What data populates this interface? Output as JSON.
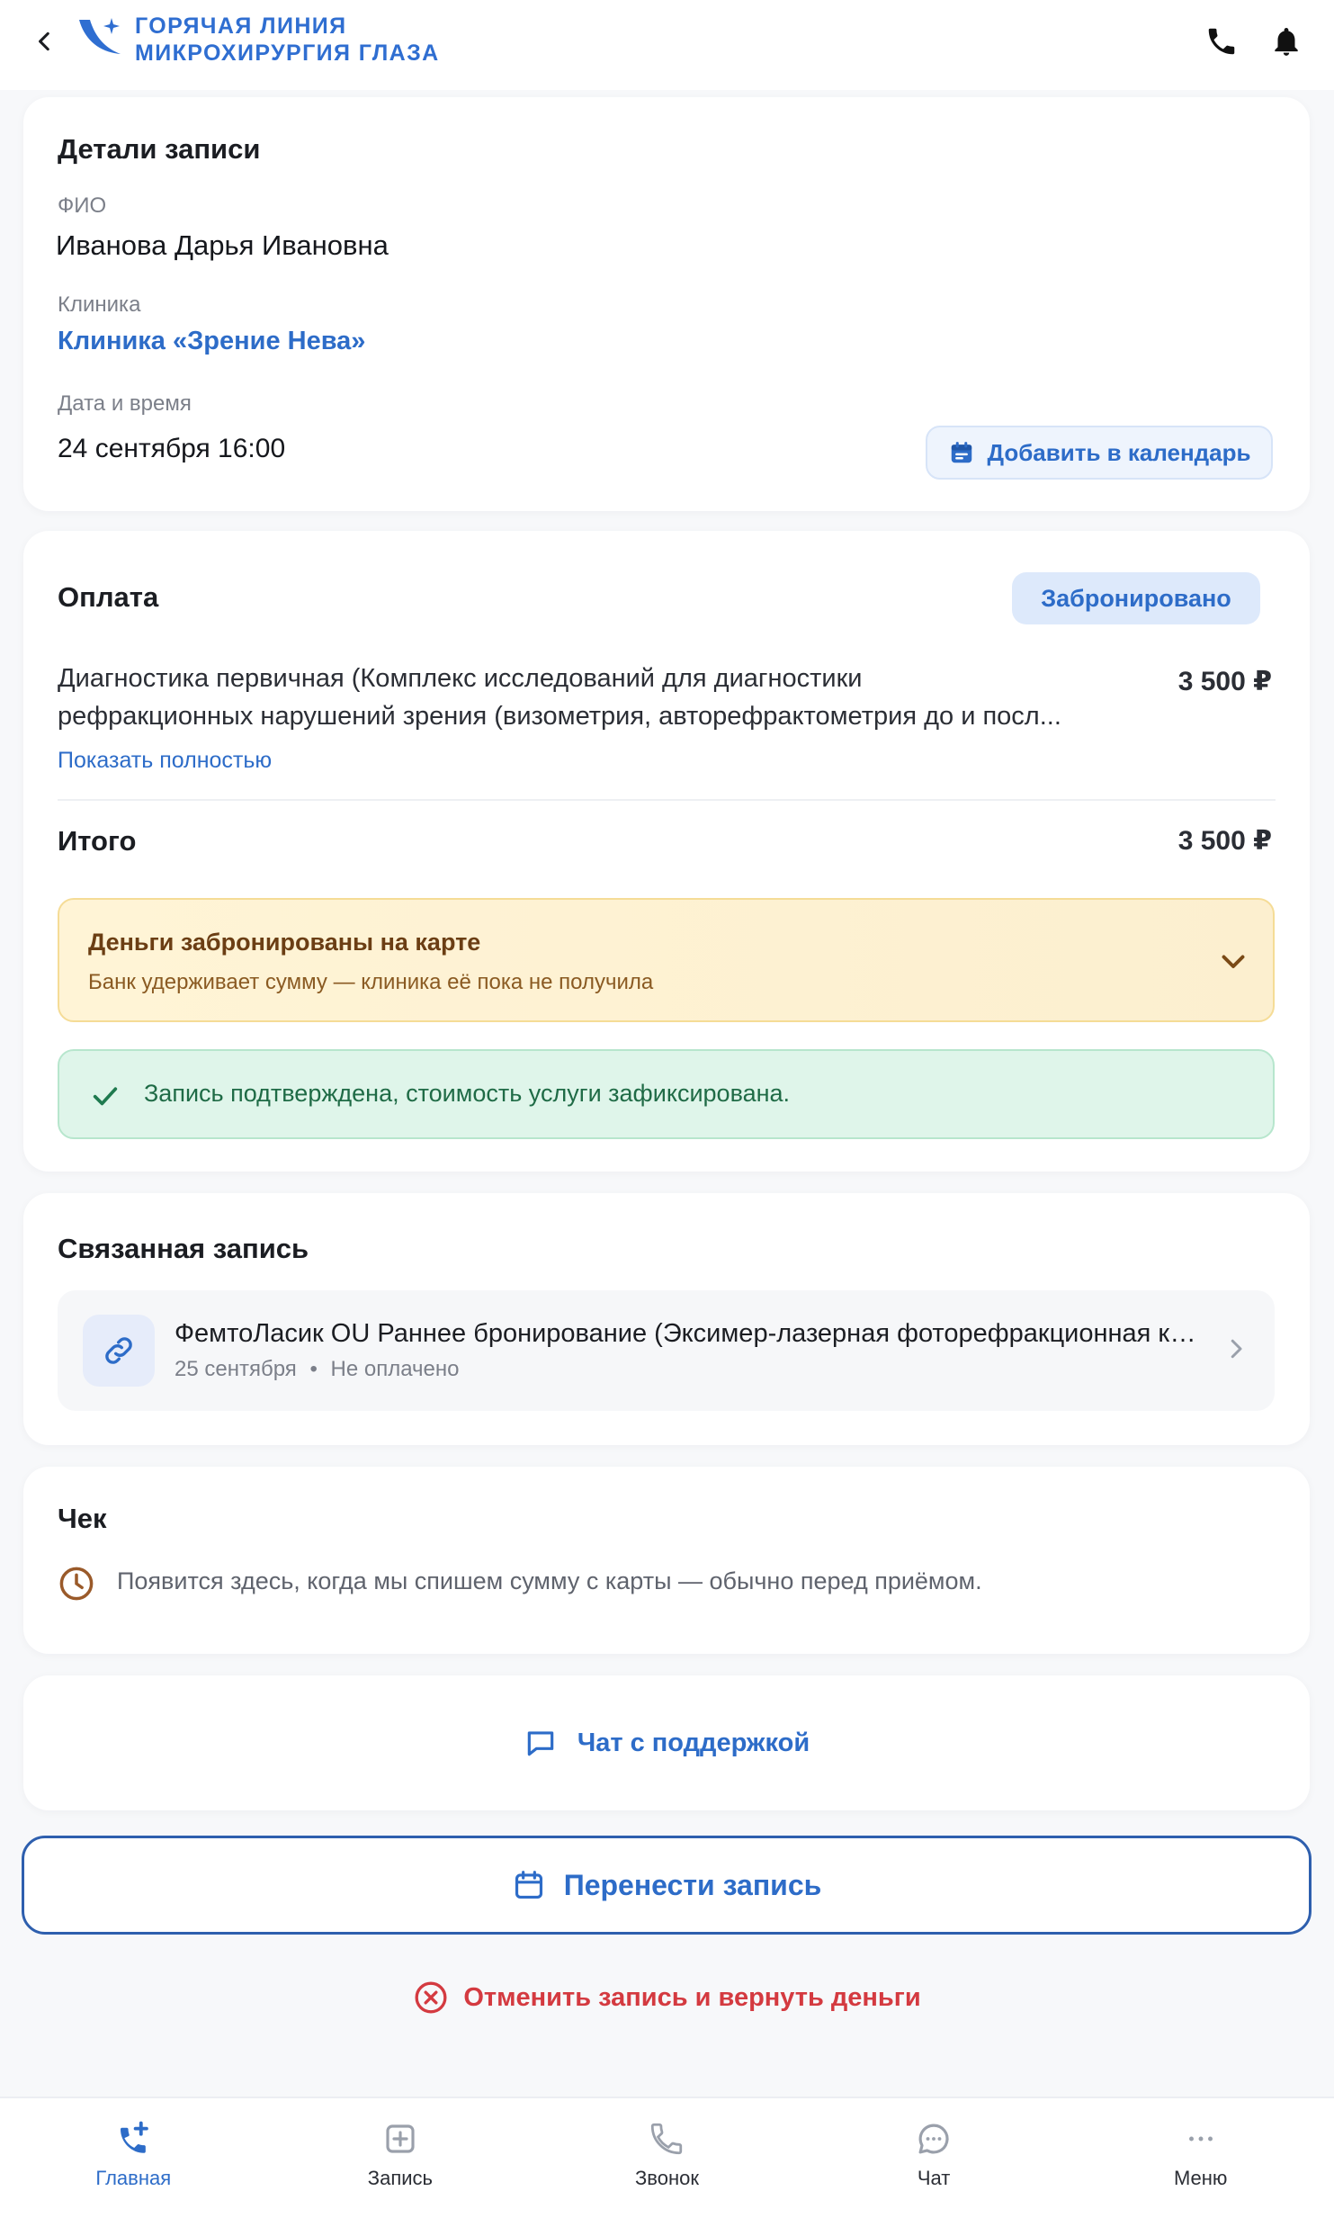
{
  "header": {
    "logo_line1": "ГОРЯЧАЯ ЛИНИЯ",
    "logo_line2": "МИКРОХИРУРГИЯ ГЛАЗА"
  },
  "details": {
    "title": "Детали записи",
    "fio_label": "ФИО",
    "fio_value": "Иванова Дарья Ивановна",
    "clinic_label": "Клиника",
    "clinic_value": "Клиника «Зрение Нева»",
    "datetime_label": "Дата и время",
    "datetime_value": "24 сентября 16:00",
    "calendar_button": "Добавить в календарь"
  },
  "payment": {
    "title": "Оплата",
    "status_badge": "Забронировано",
    "service_line1": "Диагностика первичная (Комплекс исследований для диагностики",
    "service_line2": "рефракционных нарушений зрения (визометрия, авторефрактометрия до и посл...",
    "service_price": "3 500 ₽",
    "show_more": "Показать полностью",
    "total_label": "Итого",
    "total_value": "3 500 ₽",
    "hold_notice_title": "Деньги забронированы на карте",
    "hold_notice_text": "Банк удерживает сумму — клиника её пока не получила",
    "confirmed_text": "Запись подтверждена, стоимость услуги зафиксирована."
  },
  "related": {
    "title": "Связанная запись",
    "item_title": "ФемтоЛасик OU Раннее бронирование (Эксимер-лазерная фоторефракционная кератэктомия)",
    "item_date": "25 сентября",
    "item_separator": "•",
    "item_status": "Не оплачено"
  },
  "receipt": {
    "title": "Чек",
    "text": "Появится здесь, когда мы спишем сумму с карты — обычно перед приёмом."
  },
  "actions": {
    "chat_support": "Чат с поддержкой",
    "reschedule": "Перенести запись",
    "cancel": "Отменить запись и вернуть деньги"
  },
  "tabbar": {
    "items": [
      {
        "label": "Главная",
        "icon": "phone-plus-icon",
        "active": true
      },
      {
        "label": "Запись",
        "icon": "plus-square-icon",
        "active": false
      },
      {
        "label": "Звонок",
        "icon": "phone-icon",
        "active": false
      },
      {
        "label": "Чат",
        "icon": "chat-bubble-icon",
        "active": false
      },
      {
        "label": "Меню",
        "icon": "more-dots-icon",
        "active": false
      }
    ]
  },
  "colors": {
    "accent": "#2d6cc8",
    "warning_bg": "#fff4d6",
    "success_bg": "#dff5ea",
    "danger": "#d43a40"
  }
}
